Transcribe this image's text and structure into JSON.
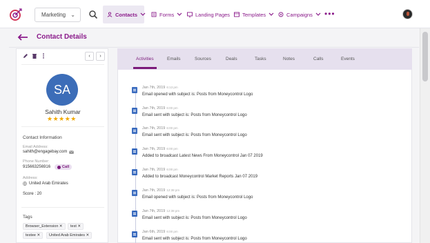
{
  "nav": {
    "workspace": "Marketing",
    "items": [
      {
        "label": "Contacts",
        "icon": "contacts-icon",
        "has_dropdown": true,
        "active": true
      },
      {
        "label": "Forms",
        "icon": "forms-icon",
        "has_dropdown": true,
        "active": false
      },
      {
        "label": "Landing Pages",
        "icon": "landing-pages-icon",
        "has_dropdown": false,
        "active": false
      },
      {
        "label": "Templates",
        "icon": "templates-icon",
        "has_dropdown": true,
        "active": false
      },
      {
        "label": "Campaigns",
        "icon": "campaigns-icon",
        "has_dropdown": true,
        "active": false
      }
    ],
    "more": "•••"
  },
  "header": {
    "title": "Contact Details"
  },
  "contact": {
    "initials": "SA",
    "name": "Sahith Kumar",
    "rating_stars": "★★★★★",
    "rating": 5,
    "info_heading": "Contact Information",
    "email_label": "Email Address:",
    "email": "sahith@engagebay.com",
    "phone_label": "Phone Number:",
    "phone": "915663256916",
    "call_label": "Call",
    "address_label": "Address:",
    "address": "United Arab Emirates",
    "score": "Score : 20",
    "tags_heading": "Tags",
    "tags": [
      "Browser_Extension",
      "test",
      "testee",
      "United Arab Emirates"
    ]
  },
  "tabs": [
    "Activities",
    "Emails",
    "Sources",
    "Deals",
    "Tasks",
    "Notes",
    "Calls",
    "Events"
  ],
  "activities": [
    {
      "date": "Jan 7th, 2019",
      "time": "6:13 pm",
      "text": "Email opened with subject is: Posts from Moneycontrol Logo"
    },
    {
      "date": "Jan 7th, 2019",
      "time": "6:00 pm",
      "text": "Email sent with subject is: Posts from Moneycontrol Logo"
    },
    {
      "date": "Jan 7th, 2019",
      "time": "6:00 pm",
      "text": "Email sent with subject is: Posts from Moneycontrol Logo"
    },
    {
      "date": "Jan 7th, 2019",
      "time": "6:00 pm",
      "text": "Added to broadcast Latest News From Moneycontrol Jan 07 2019"
    },
    {
      "date": "Jan 7th, 2019",
      "time": "6:00 pm",
      "text": "Added to broadcast Moneycontrol Market Reports Jan 07 2019"
    },
    {
      "date": "Jan 7th, 2019",
      "time": "12:38 pm",
      "text": "Email opened with subject is: Posts from Moneycontrol Logo"
    },
    {
      "date": "Jan 7th, 2019",
      "time": "12:38 pm",
      "text": "Email sent with subject is: Posts from Moneycontrol Logo"
    },
    {
      "date": "Jan 6th, 2019",
      "time": "6:00 pm",
      "text": "Email sent with subject is: Posts from Moneycontrol Logo"
    }
  ],
  "colors": {
    "brand": "#8a1a8a",
    "avatar": "#3c6db8",
    "star": "#f2a900",
    "tab_bar": "#e6e0ee"
  }
}
